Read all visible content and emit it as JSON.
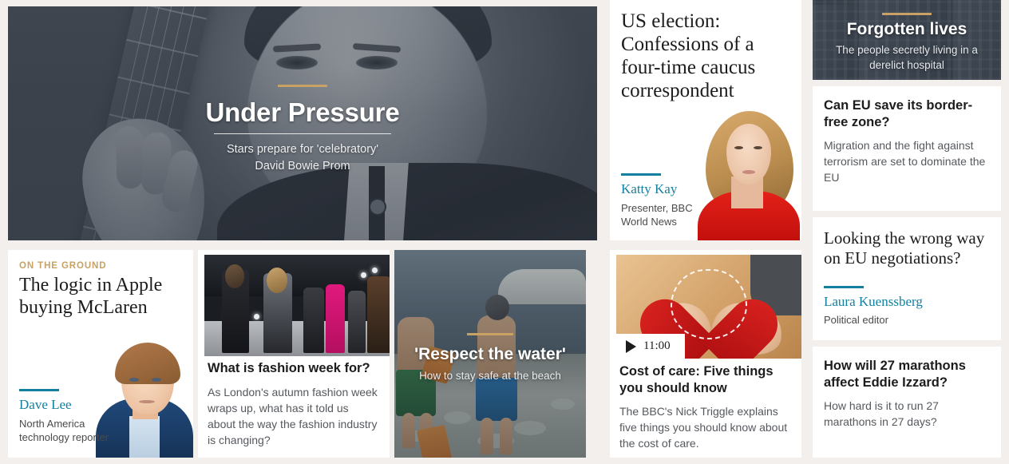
{
  "theme": {
    "page_background": "#f2efec",
    "card_background": "#ffffff",
    "accent_gold": "#c8a165",
    "accent_teal": "#1380a0",
    "headline_color": "#1c1c1c",
    "summary_color": "#55595e"
  },
  "hero": {
    "kicker_rule": "gold-rule",
    "title": "Under Pressure",
    "subtitle_line1": "Stars prepare for 'celebratory'",
    "subtitle_line2": "David Bowie Prom",
    "image_alt": "david-bowie-guitar-portrait"
  },
  "us_election": {
    "headline": "US election: Confessions of a four-time caucus correspondent",
    "byline_name": "Katty Kay",
    "byline_role_line1": "Presenter, BBC",
    "byline_role_line2": "World News",
    "image_alt": "katty-kay-portrait"
  },
  "sidebar": {
    "forgotten_lives": {
      "title": "Forgotten lives",
      "subtitle_line1": "The people secretly living in a",
      "subtitle_line2": "derelict hospital",
      "image_alt": "derelict-hospital-building"
    },
    "eu_border": {
      "headline": "Can EU save its border-free zone?",
      "summary": "Migration and the fight against terrorism are set to dominate the EU"
    },
    "eu_negotiations": {
      "headline": "Looking the wrong way on EU negotiations?",
      "byline_name": "Laura Kuenssberg",
      "byline_role": "Political editor"
    },
    "marathons": {
      "headline": "How will 27 marathons affect Eddie Izzard?",
      "summary": "How hard is it to run 27 marathons in 27 days?"
    }
  },
  "bottom_row": {
    "apple_mclaren": {
      "kicker": "ON THE GROUND",
      "headline": "The logic in Apple buying McLaren",
      "byline_name": "Dave Lee",
      "byline_role_line1": "North America",
      "byline_role_line2": "technology reporter",
      "image_alt": "dave-lee-portrait"
    },
    "fashion_week": {
      "headline": "What is fashion week for?",
      "summary": "As London's autumn fashion week wraps up, what has it told us about the way the fashion industry is changing?",
      "image_alt": "fashion-runway-models"
    },
    "respect_water": {
      "title": "'Respect the water'",
      "subtitle": "How to stay safe at the beach",
      "image_alt": "children-walking-on-beach"
    },
    "cost_of_care": {
      "video_duration": "11:00",
      "play_icon": "play-icon",
      "headline": "Cost of care: Five things you should know",
      "summary": "The BBC's Nick Triggle explains five things you should know about the cost of care.",
      "image_alt": "hands-holding-red-felt-heart"
    }
  }
}
